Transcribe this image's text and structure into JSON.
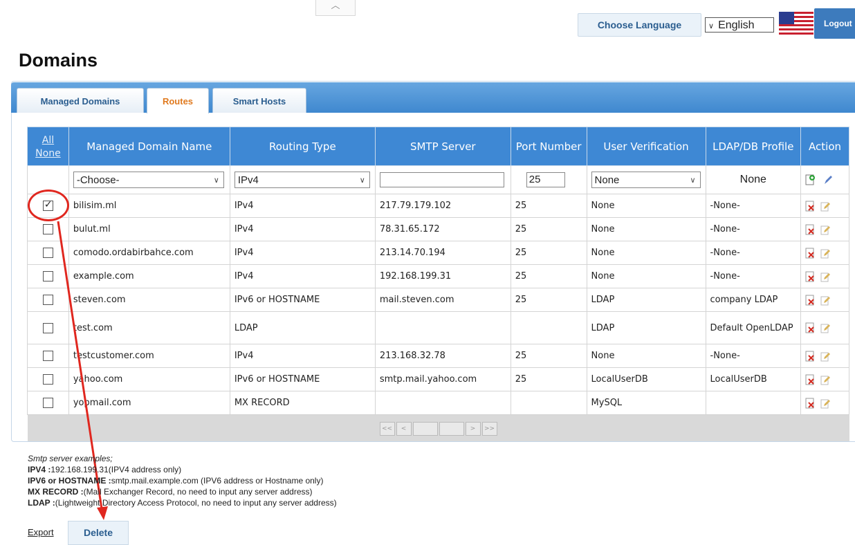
{
  "header": {
    "choose_language_label": "Choose Language",
    "language_selected": "English",
    "logout_label": "Logout"
  },
  "page": {
    "title": "Domains"
  },
  "tabs": [
    {
      "label": "Managed Domains",
      "active": false
    },
    {
      "label": "Routes",
      "active": true
    },
    {
      "label": "Smart Hosts",
      "active": false
    }
  ],
  "table": {
    "select_all_label": "All",
    "select_none_label": "None",
    "columns": [
      "Managed Domain Name",
      "Routing Type",
      "SMTP Server",
      "Port Number",
      "User Verification",
      "LDAP/DB Profile",
      "Action"
    ],
    "filter": {
      "domain": "-Choose-",
      "routing_type": "IPv4",
      "smtp_server": "",
      "port": "25",
      "user_verification": "None",
      "profile": "None"
    },
    "rows": [
      {
        "checked": true,
        "domain": "bilisim.ml",
        "routing": "IPv4",
        "smtp": "217.79.179.102",
        "port": "25",
        "verification": "None",
        "profile": "-None-"
      },
      {
        "checked": false,
        "domain": "bulut.ml",
        "routing": "IPv4",
        "smtp": "78.31.65.172",
        "port": "25",
        "verification": "None",
        "profile": "-None-"
      },
      {
        "checked": false,
        "domain": "comodo.ordabirbahce.com",
        "routing": "IPv4",
        "smtp": "213.14.70.194",
        "port": "25",
        "verification": "None",
        "profile": "-None-"
      },
      {
        "checked": false,
        "domain": "example.com",
        "routing": "IPv4",
        "smtp": "192.168.199.31",
        "port": "25",
        "verification": "None",
        "profile": "-None-"
      },
      {
        "checked": false,
        "domain": "steven.com",
        "routing": "IPv6 or HOSTNAME",
        "smtp": "mail.steven.com",
        "port": "25",
        "verification": "LDAP",
        "profile": "company LDAP"
      },
      {
        "checked": false,
        "domain": "test.com",
        "routing": "LDAP",
        "smtp": "",
        "port": "",
        "verification": "LDAP",
        "profile": "Default OpenLDAP"
      },
      {
        "checked": false,
        "domain": "testcustomer.com",
        "routing": "IPv4",
        "smtp": "213.168.32.78",
        "port": "25",
        "verification": "None",
        "profile": "-None-"
      },
      {
        "checked": false,
        "domain": "yahoo.com",
        "routing": "IPv6 or HOSTNAME",
        "smtp": "smtp.mail.yahoo.com",
        "port": "25",
        "verification": "LocalUserDB",
        "profile": "LocalUserDB"
      },
      {
        "checked": false,
        "domain": "yopmail.com",
        "routing": "MX RECORD",
        "smtp": "",
        "port": "",
        "verification": "MySQL",
        "profile": ""
      }
    ],
    "pager": [
      "<<",
      "<",
      "",
      "",
      ">",
      ">>"
    ]
  },
  "notes": {
    "heading": "Smtp server examples;",
    "lines": [
      {
        "key": "IPV4 :",
        "text": "192.168.199.31(IPV4 address only)"
      },
      {
        "key": "IPV6 or HOSTNAME :",
        "text": "smtp.mail.example.com (IPV6 address or Hostname only)"
      },
      {
        "key": "MX RECORD :",
        "text": "(Mail Exchanger Record, no need to input any server address)"
      },
      {
        "key": "LDAP :",
        "text": "(Lightweight Directory Access Protocol, no need to input any server address)"
      }
    ]
  },
  "footer": {
    "export_label": "Export",
    "delete_label": "Delete"
  },
  "colors": {
    "accent": "#3e88d4",
    "active_tab": "#e07a1f",
    "annotation": "#e0271f"
  }
}
